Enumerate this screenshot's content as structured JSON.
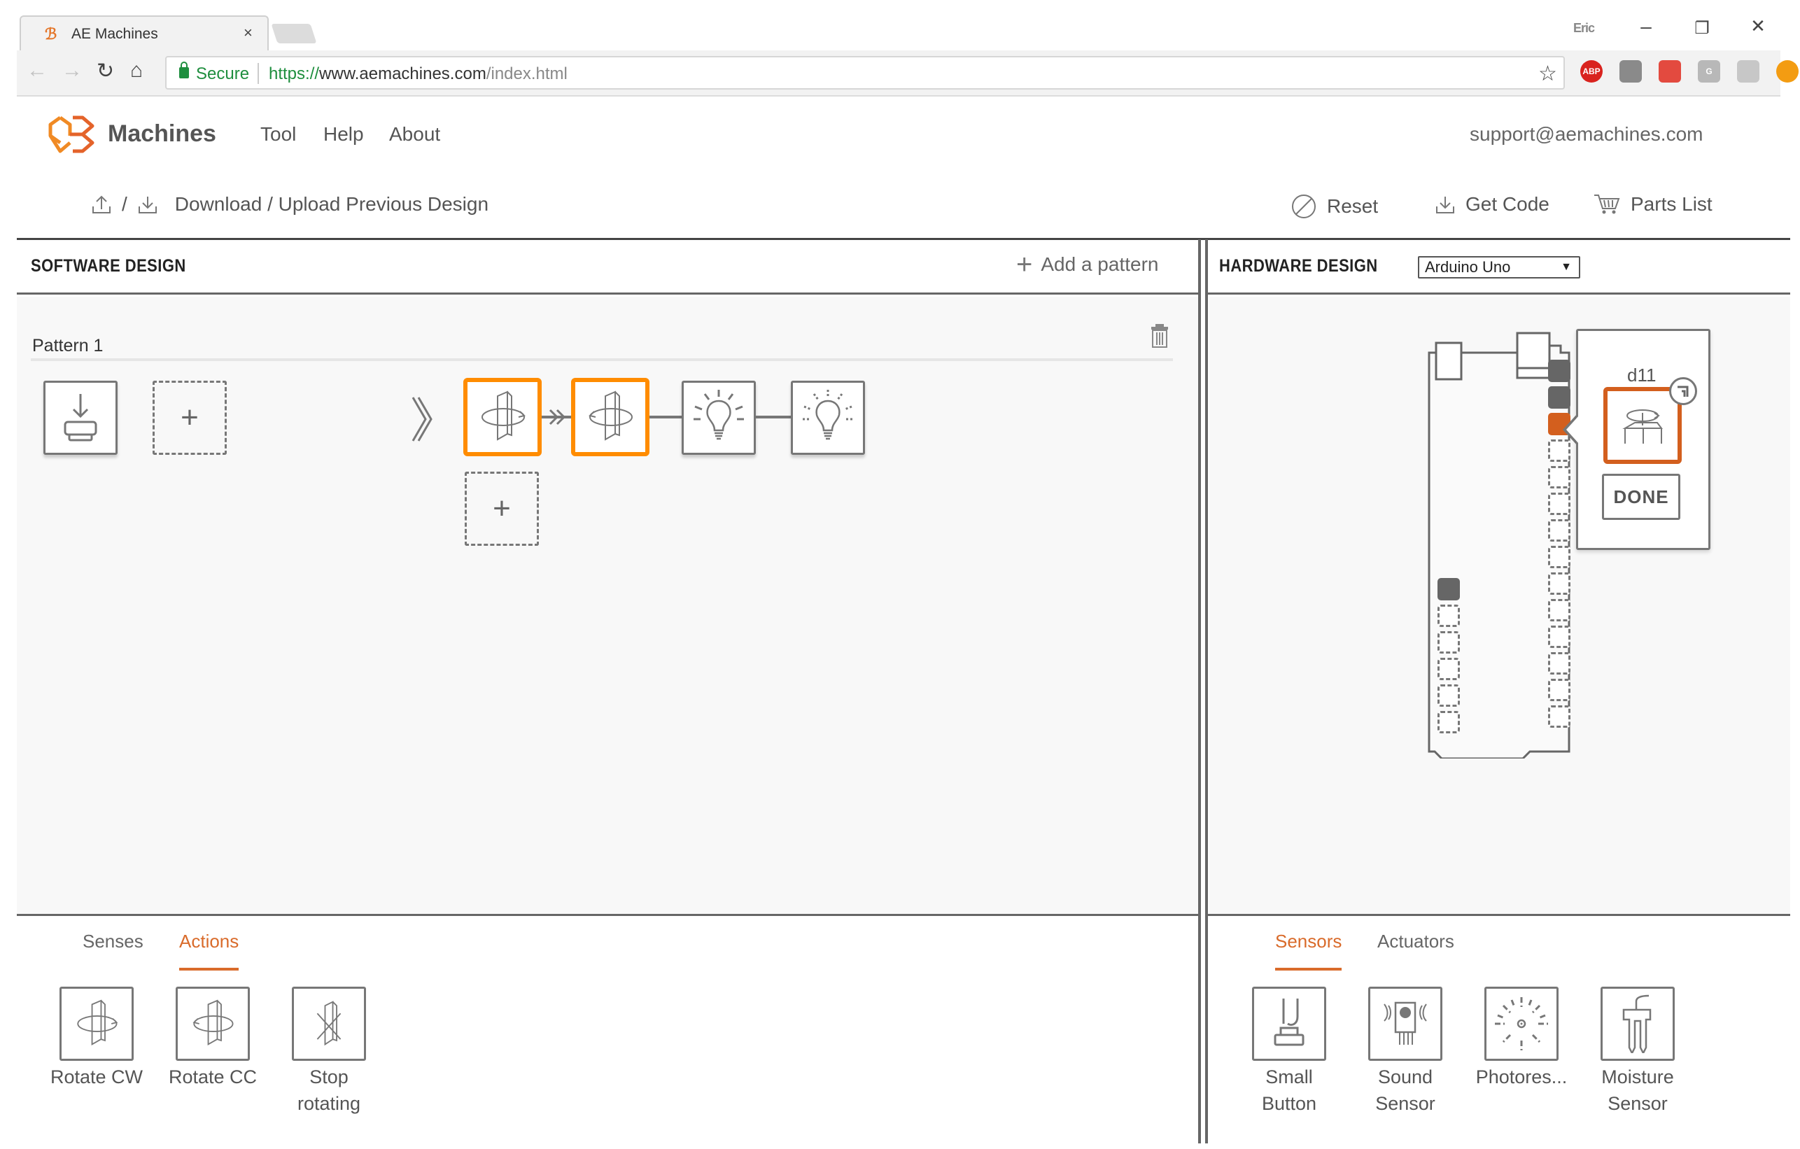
{
  "browser": {
    "tab_title": "AE Machines",
    "tab_favicon": "ae-logo-icon",
    "close_tab_glyph": "×",
    "window_user": "Eric",
    "minimize_glyph": "–",
    "restore_glyph": "❐",
    "close_glyph": "✕",
    "secure_label": "Secure",
    "url_scheme": "https://",
    "url_host": "www.aemachines.com",
    "url_path": "/index.html",
    "extensions": [
      {
        "name": "adblock-plus-icon",
        "label": "ABP",
        "color": "#d9231e"
      },
      {
        "name": "shield-extension-icon",
        "label": "",
        "color": "#8a8a8a"
      },
      {
        "name": "paw-extension-icon",
        "label": "",
        "color": "#e34a3f"
      },
      {
        "name": "g-extension-icon",
        "label": "G",
        "color": "#b8b8b8"
      },
      {
        "name": "drive-extension-icon",
        "label": "",
        "color": "#c7c7c7"
      },
      {
        "name": "upload-extension-icon",
        "label": "",
        "color": "#f39c12"
      }
    ]
  },
  "site": {
    "logo_text": "Machines",
    "nav": [
      "Tool",
      "Help",
      "About"
    ],
    "support_email": "support@aemachines.com",
    "download_upload_label": "Download / Upload Previous Design",
    "separator": "/",
    "reset_label": "Reset",
    "get_code_label": "Get Code",
    "parts_list_label": "Parts List"
  },
  "software": {
    "title": "SOFTWARE DESIGN",
    "add_pattern_label": "Add a pattern",
    "pattern": {
      "name": "Pattern 1",
      "trigger_blocks": [
        {
          "name": "button-press-block",
          "icon": "button-press-icon"
        }
      ],
      "action_blocks": [
        {
          "name": "rotate-cw-block",
          "icon": "rotate-cw-icon",
          "active": true
        },
        {
          "name": "rotate-cc-block",
          "icon": "rotate-cc-icon",
          "active": true
        },
        {
          "name": "light-on-block",
          "icon": "lightbulb-on-icon",
          "active": false
        },
        {
          "name": "light-blink-block",
          "icon": "lightbulb-blink-icon",
          "active": false
        }
      ]
    },
    "palette_tabs": [
      {
        "label": "Senses",
        "active": false
      },
      {
        "label": "Actions",
        "active": true
      }
    ],
    "palette_items": [
      {
        "label": "Rotate CW",
        "icon": "rotate-cw-icon"
      },
      {
        "label": "Rotate CC",
        "icon": "rotate-cc-icon"
      },
      {
        "label": "Stop rotating",
        "icon": "stop-rotating-icon"
      }
    ]
  },
  "hardware": {
    "title": "HARDWARE DESIGN",
    "board_select": "Arduino Uno",
    "selected_pin": "d11",
    "done_label": "DONE",
    "right_header_pins": [
      "used",
      "used",
      "selected",
      "free",
      "free",
      "free",
      "free",
      "free",
      "free",
      "free",
      "free",
      "free",
      "free",
      "free"
    ],
    "left_header_pins": [
      "used",
      "free",
      "free",
      "free",
      "free",
      "free"
    ],
    "palette_tabs": [
      {
        "label": "Sensors",
        "active": true
      },
      {
        "label": "Actuators",
        "active": false
      }
    ],
    "palette_items": [
      {
        "label": "Small Button",
        "icon": "small-button-icon"
      },
      {
        "label": "Sound Sensor",
        "icon": "sound-sensor-icon"
      },
      {
        "label": "Photores...",
        "icon": "photoresistor-icon"
      },
      {
        "label": "Moisture Sensor",
        "icon": "moisture-sensor-icon"
      }
    ]
  },
  "colors": {
    "accent_orange": "#ff8c00",
    "brand_orange": "#d96b2b",
    "pin_selected": "#d35f1e",
    "pin_used": "#666666",
    "secure_green": "#1e8e3e"
  }
}
